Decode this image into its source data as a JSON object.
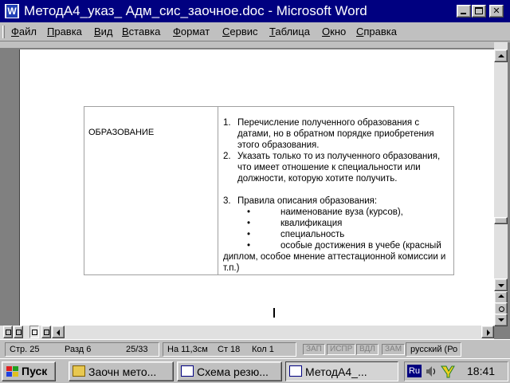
{
  "window": {
    "title": "МетодА4_указ_ Адм_сис_заочное.doc - Microsoft Word",
    "app_icon": "word-icon",
    "controls": {
      "minimize": "minimize-icon",
      "maximize": "maximize-icon",
      "close": "✕"
    }
  },
  "menu": {
    "items": [
      {
        "label": "Файл"
      },
      {
        "label": "Правка"
      },
      {
        "label": "Вид"
      },
      {
        "label": "Вставка"
      },
      {
        "label": "Формат"
      },
      {
        "label": "Сервис"
      },
      {
        "label": "Таблица"
      },
      {
        "label": "Окно"
      },
      {
        "label": "Справка"
      }
    ]
  },
  "document": {
    "section_label": "ОБРАЗОВАНИЕ",
    "list": [
      {
        "num": "1.",
        "text": "Перечисление полученного образования с датами, но в обратном порядке приобретения этого образования."
      },
      {
        "num": "2.",
        "text": "Указать только то из полученного образования, что имеет отношение к специальности или должности, которую хотите получить."
      },
      {
        "num": "3.",
        "text": "Правила описания образования:"
      }
    ],
    "bullets": [
      {
        "mark": "•",
        "text": "наименование вуза (курсов),"
      },
      {
        "mark": "•",
        "text": "квалификация"
      },
      {
        "mark": "•",
        "text": "специальность"
      },
      {
        "mark": "•",
        "text": "особые достижения в учебе (красный"
      }
    ],
    "bullet_continuation": "диплом, особое мнение аттестационной комиссии и т.п.)"
  },
  "status": {
    "page": "Стр. 25",
    "section": "Разд 6",
    "pages": "25/33",
    "at": "На 11,3см",
    "line": "Ст 18",
    "col": "Кол 1",
    "indicators": [
      "ЗАП",
      "ИСПР",
      "ВДЛ",
      "ЗАМ"
    ],
    "language": "русский (Ро"
  },
  "taskbar": {
    "start_label": "Пуск",
    "tasks": [
      {
        "label": "Заочн мето...",
        "icon": "folder-icon",
        "active": false
      },
      {
        "label": "Схема резю...",
        "icon": "word-doc-icon",
        "active": false
      },
      {
        "label": "МетодА4_...",
        "icon": "word-doc-icon",
        "active": true
      }
    ],
    "tray": {
      "lang": "Ru",
      "icons": [
        "speaker-icon",
        "scheduler-icon"
      ],
      "clock": "18:41"
    }
  },
  "colors": {
    "titlebar": "#000080",
    "chrome": "#c0c0c0",
    "page": "#ffffff",
    "workspace": "#808080"
  }
}
